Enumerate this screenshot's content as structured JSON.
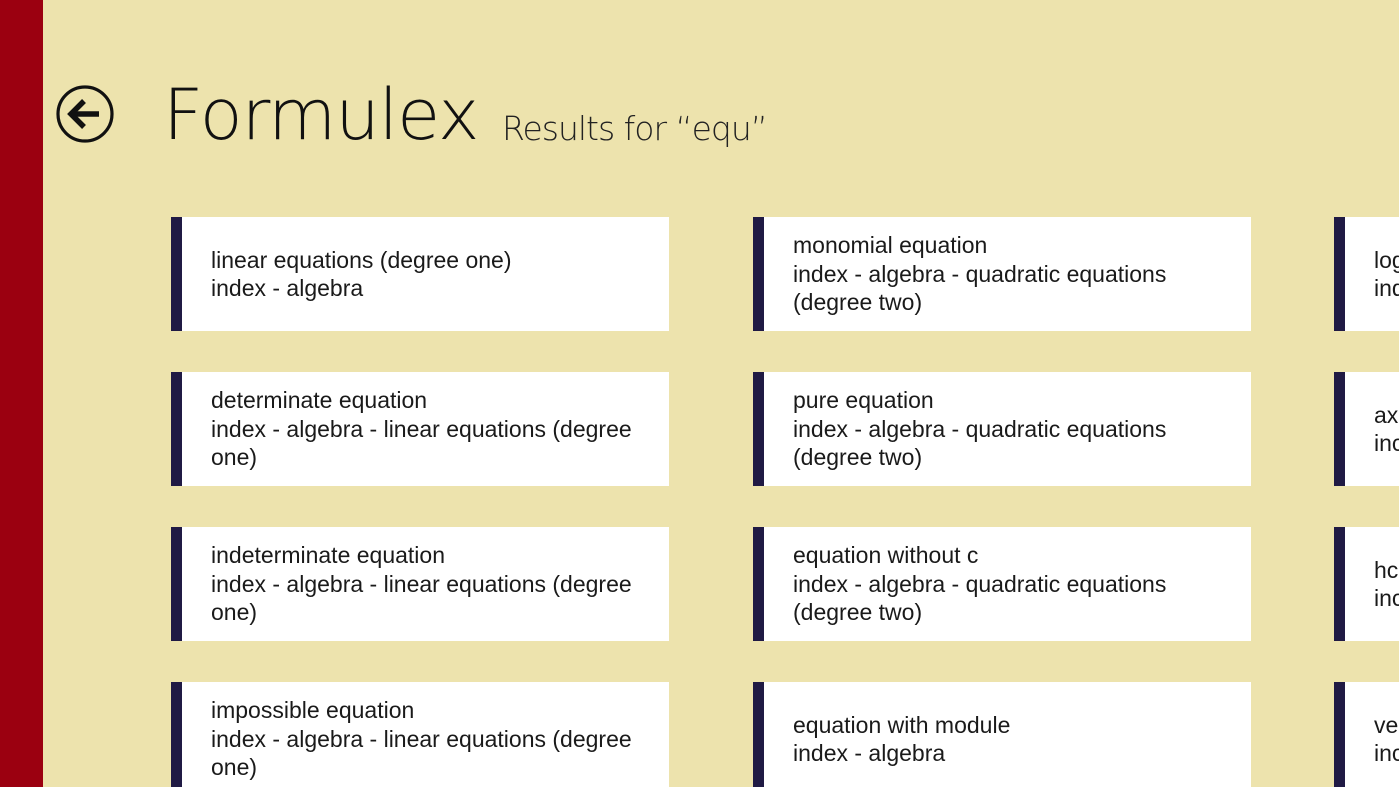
{
  "app": {
    "title": "Formulex",
    "subtitle": "Results for “equ”"
  },
  "colors": {
    "background": "#EDE3AD",
    "side_stripe": "#9B0010",
    "tile_accent": "#201A44",
    "tile_background": "#FFFFFF"
  },
  "icons": {
    "back": "back-arrow-circle-icon"
  },
  "results": [
    {
      "title": "linear equations (degree one)",
      "path": "index - algebra"
    },
    {
      "title": "determinate equation",
      "path": "index - algebra - linear equations (degree one)"
    },
    {
      "title": "indeterminate equation",
      "path": "index - algebra - linear equations (degree one)"
    },
    {
      "title": "impossible equation",
      "path": "index - algebra - linear equations (degree one)"
    },
    {
      "title": "monomial equation",
      "path": "index - algebra - quadratic equations (degree two)"
    },
    {
      "title": "pure equation",
      "path": "index - algebra - quadratic equations (degree two)"
    },
    {
      "title": "equation without c",
      "path": "index - algebra - quadratic equations (degree two)"
    },
    {
      "title": "equation with module",
      "path": "index - algebra"
    },
    {
      "title": "log",
      "path": "ind"
    },
    {
      "title": "ax",
      "path": "inc"
    },
    {
      "title": "hc",
      "path": "inc"
    },
    {
      "title": "ve",
      "path": "inc"
    }
  ]
}
